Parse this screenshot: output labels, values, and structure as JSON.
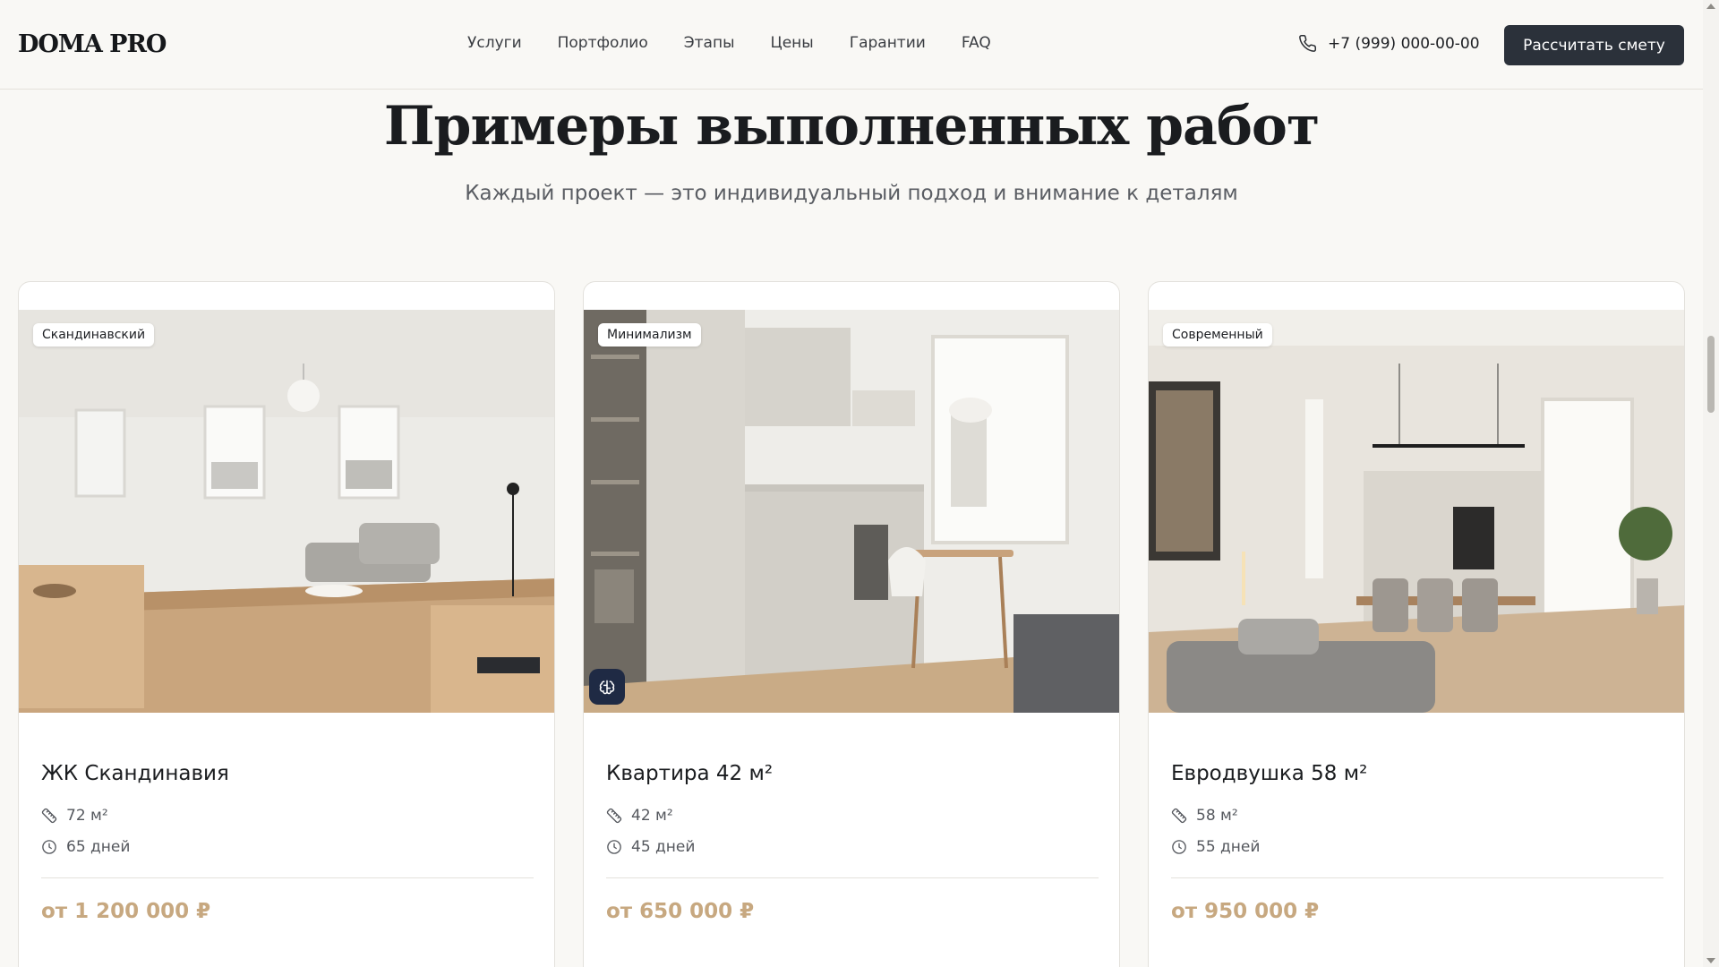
{
  "header": {
    "logo": "DOMA PRO",
    "nav": [
      "Услуги",
      "Портфолио",
      "Этапы",
      "Цены",
      "Гарантии",
      "FAQ"
    ],
    "phone": "+7 (999) 000-00-00",
    "cta_label": "Рассчитать смету"
  },
  "section": {
    "title": "Примеры выполненных работ",
    "subtitle": "Каждый проект — это индивидуальный подход и внимание к деталям"
  },
  "projects": [
    {
      "style": "Скандинавский",
      "title": "ЖК Скандинавия",
      "area": "72 м²",
      "duration": "65 дней",
      "price": "от 1 200 000 ₽"
    },
    {
      "style": "Минимализм",
      "title": "Квартира 42 м²",
      "area": "42 м²",
      "duration": "45 дней",
      "price": "от 650 000 ₽"
    },
    {
      "style": "Современный",
      "title": "Евродвушка 58 м²",
      "area": "58 м²",
      "duration": "55 дней",
      "price": "от 950 000 ₽"
    }
  ],
  "colors": {
    "background": "#f9f8f5",
    "cta": "#2b313a",
    "price_accent": "#c7a880",
    "card_bg": "#ffffff"
  },
  "icons": {
    "phone": "phone-icon",
    "area": "ruler-icon",
    "duration": "clock-icon",
    "ai_badge": "brain-icon"
  }
}
